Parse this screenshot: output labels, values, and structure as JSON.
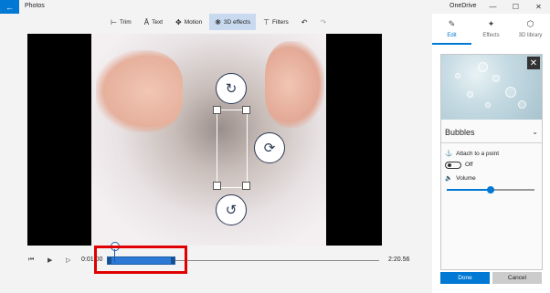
{
  "app": {
    "title": "Photos",
    "back_icon": "←"
  },
  "window_controls": {
    "minimize": "—",
    "maximize": "☐",
    "close": "✕"
  },
  "onedrive": {
    "label": "OneDrive"
  },
  "toolbar": {
    "items": [
      {
        "label": "Trim",
        "icon": "⊢"
      },
      {
        "label": "Text",
        "icon": "Ā"
      },
      {
        "label": "Motion",
        "icon": "✥"
      },
      {
        "label": "3D effects",
        "icon": "❋",
        "active": true
      },
      {
        "label": "Filters",
        "icon": "⊤"
      }
    ],
    "undo_icon": "↶",
    "redo_icon": "↷"
  },
  "preview": {
    "rotate_top_icon": "↻",
    "rotate_right_icon": "⟳",
    "rotate_bottom_icon": "↺"
  },
  "playback": {
    "rewind_icon": "⏮",
    "play_icon": "▶",
    "next_icon": "▷",
    "current_time": "0:01.00",
    "total_time": "2:20.56"
  },
  "panel": {
    "tabs": [
      {
        "label": "Edit",
        "icon": "✎",
        "active": true
      },
      {
        "label": "Effects",
        "icon": "✦"
      },
      {
        "label": "3D library",
        "icon": "⬡"
      }
    ],
    "effect": {
      "name": "Bubbles",
      "close_icon": "✕",
      "expand_icon": "⌄",
      "attach_label": "Attach to a point",
      "attach_icon": "⚓",
      "toggle_state": "Off",
      "volume_label": "Volume",
      "volume_icon": "🔈",
      "volume_value": 0.5
    },
    "done_label": "Done",
    "cancel_label": "Cancel"
  },
  "colors": {
    "accent": "#0078d4",
    "highlight": "#e00000"
  }
}
